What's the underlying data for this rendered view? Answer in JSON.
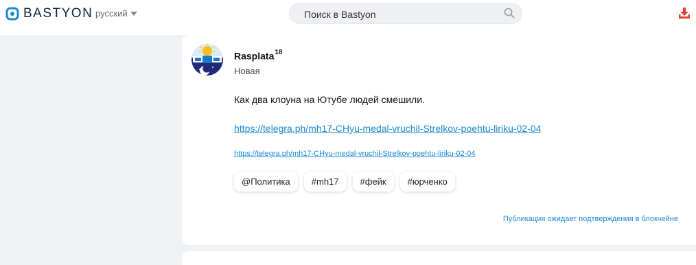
{
  "header": {
    "logo_text": "BASTYON",
    "language": "русский",
    "search_placeholder": "Поиск в Bastyon"
  },
  "post": {
    "author": "Rasplata",
    "author_badge": "18",
    "status": "Новая",
    "text": "Как два клоуна на Ютубе людей смешили.",
    "link_url": "https://telegra.ph/mh17-CHyu-medal-vruchil-Strelkov-poehtu-liriku-02-04",
    "link_preview_url": "https://telegra.ph/mh17-CHyu-medal-vruchil-Strelkov-poehtu-liriku-02-04",
    "tags": [
      "@Политика",
      "#mh17",
      "#фейк",
      "#юрченко"
    ],
    "pending_note": "Публикация ожидает подтверждения в блокчейне"
  },
  "colors": {
    "accent": "#1a88d4",
    "download_icon": "#e2412a",
    "background": "#f0f1f4"
  },
  "icons": {
    "logo": "bastyon-logo-icon",
    "search": "search-icon",
    "download": "download-icon",
    "caret": "chevron-down-icon"
  }
}
